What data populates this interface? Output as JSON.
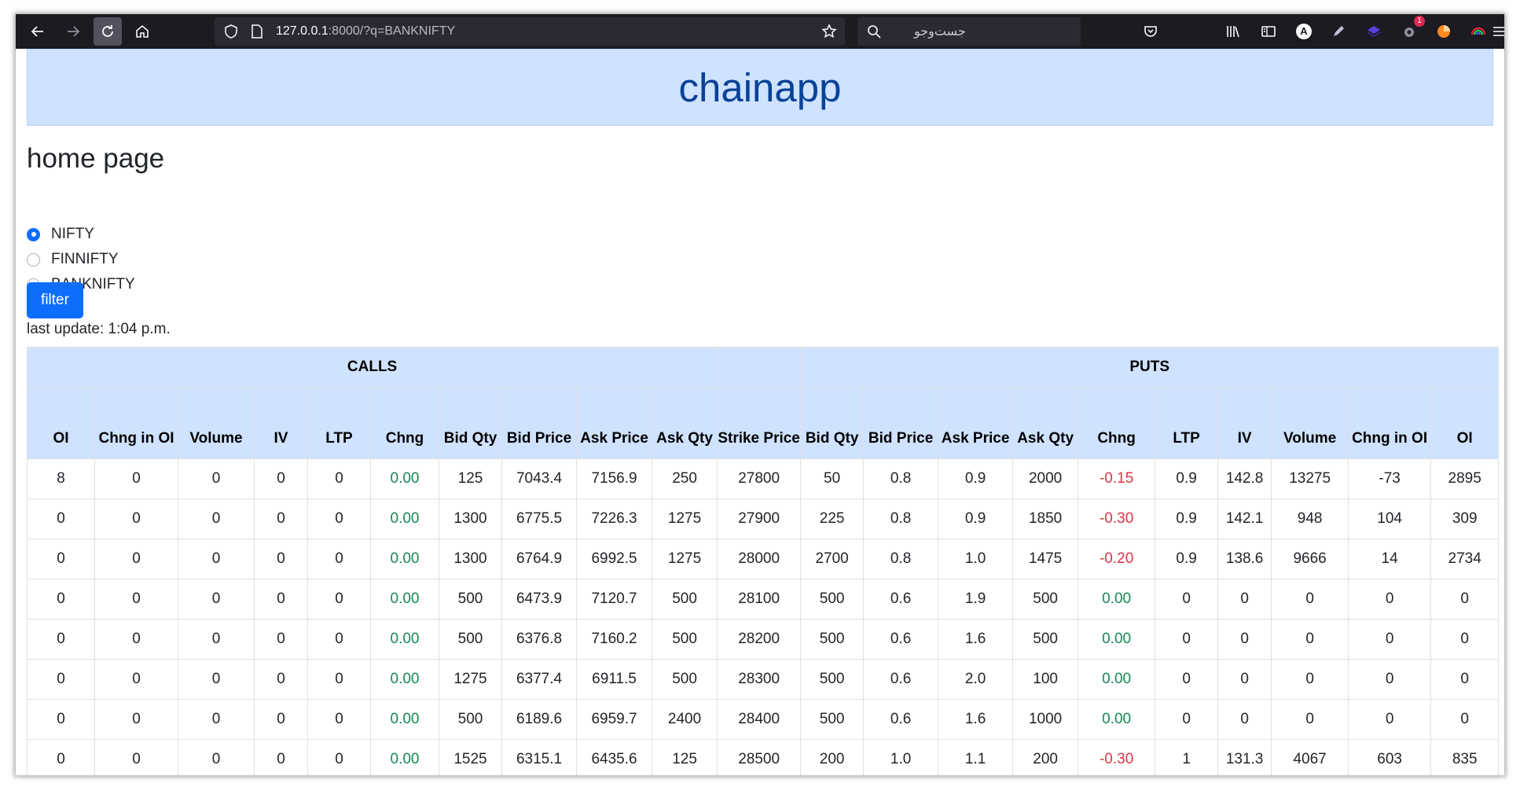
{
  "browser": {
    "url_host": "127.0.0.1",
    "url_rest": ":8000/?q=BANKNIFTY",
    "search_placeholder": "جست‌وجو",
    "notification_count": "1",
    "account_initial": "A"
  },
  "app": {
    "title": "chainapp",
    "page_title": "home page",
    "radio_options": [
      {
        "label": "NIFTY",
        "checked": true
      },
      {
        "label": "FINNIFTY",
        "checked": false
      },
      {
        "label": "BANKNIFTY",
        "checked": false
      }
    ],
    "filter_label": "filter",
    "last_update": "last update: 1:04 p.m."
  },
  "table": {
    "calls_label": "CALLS",
    "puts_label": "PUTS",
    "columns": [
      "OI",
      "Chng in OI",
      "Volume",
      "IV",
      "LTP",
      "Chng",
      "Bid Qty",
      "Bid Price",
      "Ask Price",
      "Ask Qty",
      "Strike Price",
      "Bid Qty",
      "Bid Price",
      "Ask Price",
      "Ask Qty",
      "Chng",
      "LTP",
      "IV",
      "Volume",
      "Chng in OI",
      "OI"
    ],
    "rows": [
      [
        "8",
        "0",
        "0",
        "0",
        "0",
        "0.00",
        "125",
        "7043.4",
        "7156.9",
        "250",
        "27800",
        "50",
        "0.8",
        "0.9",
        "2000",
        "-0.15",
        "0.9",
        "142.8",
        "13275",
        "-73",
        "2895"
      ],
      [
        "0",
        "0",
        "0",
        "0",
        "0",
        "0.00",
        "1300",
        "6775.5",
        "7226.3",
        "1275",
        "27900",
        "225",
        "0.8",
        "0.9",
        "1850",
        "-0.30",
        "0.9",
        "142.1",
        "948",
        "104",
        "309"
      ],
      [
        "0",
        "0",
        "0",
        "0",
        "0",
        "0.00",
        "1300",
        "6764.9",
        "6992.5",
        "1275",
        "28000",
        "2700",
        "0.8",
        "1.0",
        "1475",
        "-0.20",
        "0.9",
        "138.6",
        "9666",
        "14",
        "2734"
      ],
      [
        "0",
        "0",
        "0",
        "0",
        "0",
        "0.00",
        "500",
        "6473.9",
        "7120.7",
        "500",
        "28100",
        "500",
        "0.6",
        "1.9",
        "500",
        "0.00",
        "0",
        "0",
        "0",
        "0",
        "0"
      ],
      [
        "0",
        "0",
        "0",
        "0",
        "0",
        "0.00",
        "500",
        "6376.8",
        "7160.2",
        "500",
        "28200",
        "500",
        "0.6",
        "1.6",
        "500",
        "0.00",
        "0",
        "0",
        "0",
        "0",
        "0"
      ],
      [
        "0",
        "0",
        "0",
        "0",
        "0",
        "0.00",
        "1275",
        "6377.4",
        "6911.5",
        "500",
        "28300",
        "500",
        "0.6",
        "2.0",
        "100",
        "0.00",
        "0",
        "0",
        "0",
        "0",
        "0"
      ],
      [
        "0",
        "0",
        "0",
        "0",
        "0",
        "0.00",
        "500",
        "6189.6",
        "6959.7",
        "2400",
        "28400",
        "500",
        "0.6",
        "1.6",
        "1000",
        "0.00",
        "0",
        "0",
        "0",
        "0",
        "0"
      ],
      [
        "0",
        "0",
        "0",
        "0",
        "0",
        "0.00",
        "1525",
        "6315.1",
        "6435.6",
        "125",
        "28500",
        "200",
        "1.0",
        "1.1",
        "200",
        "-0.30",
        "1",
        "131.3",
        "4067",
        "603",
        "835"
      ],
      [
        "",
        "",
        "",
        "",
        "",
        "",
        "",
        "",
        "",
        "",
        "",
        "",
        "",
        "",
        "",
        "",
        "",
        "",
        "",
        "",
        ""
      ]
    ]
  },
  "colors": {
    "positive": "#198754",
    "negative": "#dc3545",
    "header_bg": "#cfe2ff",
    "primary": "#0d6efd"
  }
}
